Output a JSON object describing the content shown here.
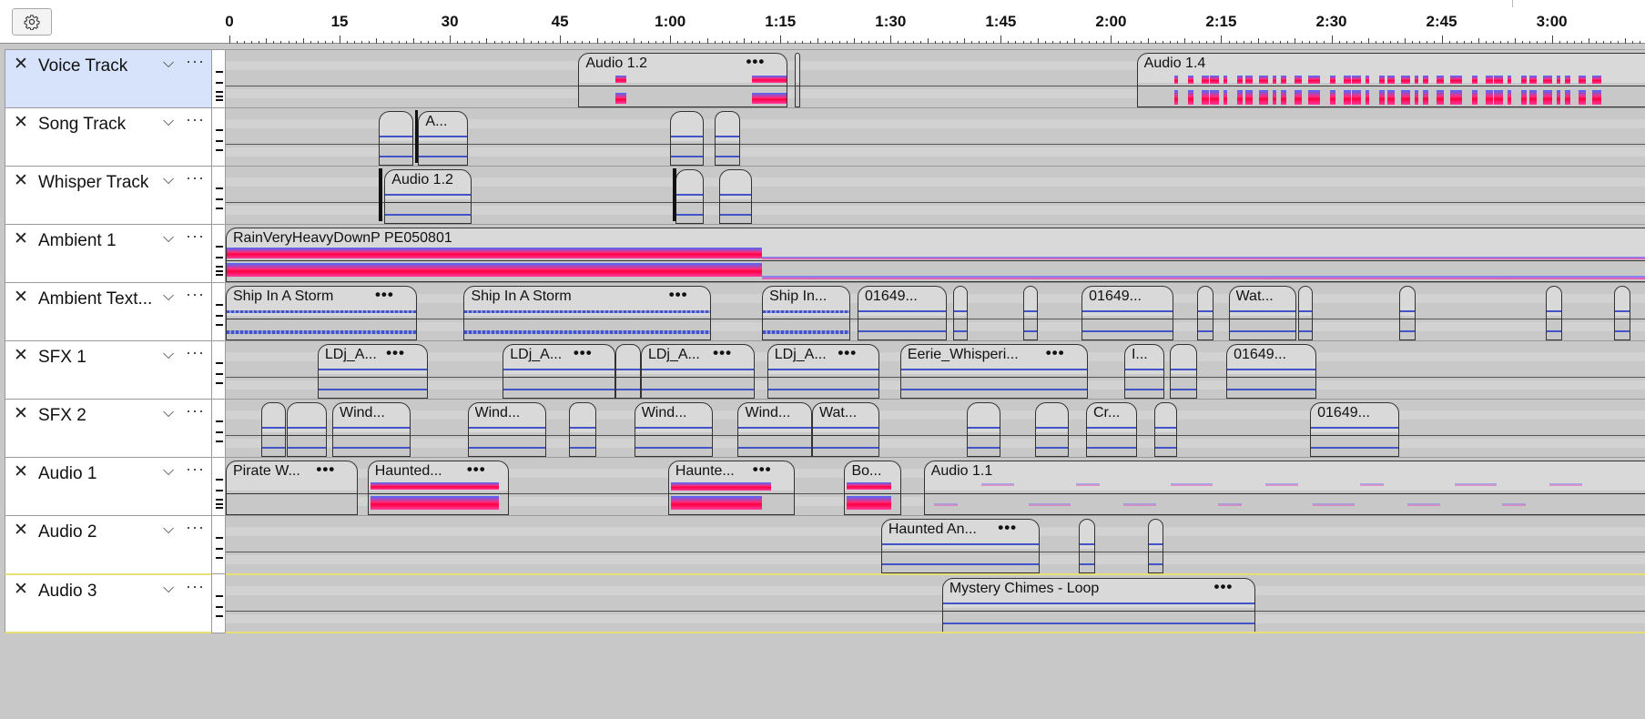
{
  "ruler": {
    "ticks": [
      "0",
      "15",
      "30",
      "45",
      "1:00",
      "1:15",
      "1:30",
      "1:45",
      "2:00",
      "2:15",
      "2:30",
      "2:45",
      "3:00"
    ]
  },
  "icons": {
    "settings": "gear-icon",
    "close": "close-icon",
    "collapse": "chevron-down-icon",
    "menu": "more-horizontal-icon"
  },
  "colors": {
    "selected_track": "#d7e3fb",
    "waveform": "#4354c8",
    "spectrogram_hot": "#ff0040",
    "spectrogram_cool": "#4b6bff",
    "focus_border": "#e6e07a"
  },
  "tracks": [
    {
      "name": "Voice Track",
      "selected": true,
      "clips": [
        {
          "title": "Audio 1.2",
          "dots": "•••",
          "start": 48,
          "end": 76.5,
          "style": "spec-ends"
        },
        {
          "title": "",
          "dots": "",
          "start": 77.5,
          "end": 77.9,
          "style": "plain"
        },
        {
          "title": "Audio 1.4",
          "dots": "",
          "start": 124,
          "end": 196,
          "style": "spec-dense"
        }
      ]
    },
    {
      "name": "Song Track",
      "clips": [
        {
          "title": "",
          "dots": "",
          "start": 20.8,
          "end": 25.5,
          "style": "wave"
        },
        {
          "title": "A...",
          "dots": "",
          "start": 26.2,
          "end": 33,
          "style": "wave"
        },
        {
          "title": "",
          "dots": "",
          "start": 60.5,
          "end": 65,
          "style": "wave"
        },
        {
          "title": "",
          "dots": "",
          "start": 66.5,
          "end": 70,
          "style": "wave"
        }
      ]
    },
    {
      "name": "Whisper Track",
      "clips": [
        {
          "title": "Audio 1.2",
          "dots": "",
          "start": 21.6,
          "end": 33.5,
          "style": "wave"
        },
        {
          "title": "",
          "dots": "",
          "start": 61.2,
          "end": 65,
          "style": "wave"
        },
        {
          "title": "",
          "dots": "",
          "start": 67.2,
          "end": 71.6,
          "style": "wave"
        }
      ]
    },
    {
      "name": "Ambient 1",
      "clips": [
        {
          "title": "RainVeryHeavyDownP PE050801",
          "dots": "",
          "start": 0,
          "end": 196,
          "style": "spec-rain"
        }
      ]
    },
    {
      "name": "Ambient Text...",
      "clips": [
        {
          "title": "Ship In A Storm",
          "dots": "•••",
          "start": 0,
          "end": 26,
          "style": "wave-noisy"
        },
        {
          "title": "Ship In A Storm",
          "dots": "•••",
          "start": 32.4,
          "end": 66,
          "style": "wave-noisy"
        },
        {
          "title": "Ship In...",
          "dots": "",
          "start": 73,
          "end": 85,
          "style": "wave-noisy"
        },
        {
          "title": "01649...",
          "dots": "",
          "start": 86,
          "end": 98.2,
          "style": "wave"
        },
        {
          "title": "",
          "dots": "",
          "start": 99,
          "end": 101,
          "style": "wave"
        },
        {
          "title": "",
          "dots": "",
          "start": 108.5,
          "end": 110.5,
          "style": "wave"
        },
        {
          "title": "01649...",
          "dots": "",
          "start": 116.5,
          "end": 129,
          "style": "wave"
        },
        {
          "title": "",
          "dots": "",
          "start": 132.2,
          "end": 134.4,
          "style": "wave"
        },
        {
          "title": "Wat...",
          "dots": "",
          "start": 136.5,
          "end": 145.7,
          "style": "wave"
        },
        {
          "title": "",
          "dots": "",
          "start": 146,
          "end": 148,
          "style": "wave"
        },
        {
          "title": "",
          "dots": "",
          "start": 159.7,
          "end": 161.9,
          "style": "wave"
        },
        {
          "title": "",
          "dots": "",
          "start": 179.7,
          "end": 181.9,
          "style": "wave"
        },
        {
          "title": "",
          "dots": "",
          "start": 189,
          "end": 191.2,
          "style": "wave"
        }
      ]
    },
    {
      "name": "SFX 1",
      "clips": [
        {
          "title": "LDj_A...",
          "dots": "•••",
          "start": 12.5,
          "end": 27.5,
          "style": "wave"
        },
        {
          "title": "LDj_A...",
          "dots": "•••",
          "start": 37.7,
          "end": 53,
          "style": "wave"
        },
        {
          "title": "",
          "dots": "",
          "start": 53,
          "end": 56.5,
          "style": "wave"
        },
        {
          "title": "LDj_A...",
          "dots": "•••",
          "start": 56.5,
          "end": 72,
          "style": "wave"
        },
        {
          "title": "LDj_A...",
          "dots": "•••",
          "start": 73.7,
          "end": 89,
          "style": "wave"
        },
        {
          "title": "Eerie_Whisperi...",
          "dots": "•••",
          "start": 91.8,
          "end": 117.3,
          "style": "wave"
        },
        {
          "title": "I...",
          "dots": "",
          "start": 122.3,
          "end": 127.7,
          "style": "wave"
        },
        {
          "title": "",
          "dots": "",
          "start": 128.5,
          "end": 132.2,
          "style": "wave"
        },
        {
          "title": "01649...",
          "dots": "",
          "start": 136.2,
          "end": 148.5,
          "style": "wave"
        }
      ]
    },
    {
      "name": "SFX 2",
      "clips": [
        {
          "title": "",
          "dots": "",
          "start": 4.8,
          "end": 8.2,
          "style": "wave"
        },
        {
          "title": "",
          "dots": "",
          "start": 8.3,
          "end": 13.7,
          "style": "wave"
        },
        {
          "title": "Wind...",
          "dots": "",
          "start": 14.5,
          "end": 25.2,
          "style": "wave"
        },
        {
          "title": "Wind...",
          "dots": "",
          "start": 32.9,
          "end": 43.6,
          "style": "wave"
        },
        {
          "title": "",
          "dots": "",
          "start": 46.7,
          "end": 50.4,
          "style": "wave"
        },
        {
          "title": "Wind...",
          "dots": "",
          "start": 55.6,
          "end": 66.3,
          "style": "wave"
        },
        {
          "title": "Wind...",
          "dots": "",
          "start": 69.7,
          "end": 79.8,
          "style": "wave"
        },
        {
          "title": "Wat...",
          "dots": "",
          "start": 79.8,
          "end": 89,
          "style": "wave"
        },
        {
          "title": "",
          "dots": "",
          "start": 100.9,
          "end": 105.4,
          "style": "wave"
        },
        {
          "title": "",
          "dots": "",
          "start": 110.2,
          "end": 114.8,
          "style": "wave"
        },
        {
          "title": "Cr...",
          "dots": "",
          "start": 117.1,
          "end": 124.1,
          "style": "wave"
        },
        {
          "title": "",
          "dots": "",
          "start": 126.4,
          "end": 129.5,
          "style": "wave"
        },
        {
          "title": "01649...",
          "dots": "",
          "start": 147.6,
          "end": 159.7,
          "style": "wave"
        }
      ]
    },
    {
      "name": "Audio 1",
      "clips": [
        {
          "title": "Pirate W...",
          "dots": "•••",
          "start": 0,
          "end": 18,
          "style": "plain"
        },
        {
          "title": "Haunted...",
          "dots": "•••",
          "start": 19.3,
          "end": 38.5,
          "style": "spec-block"
        },
        {
          "title": "Haunte...",
          "dots": "•••",
          "start": 60.2,
          "end": 77.4,
          "style": "spec-fade"
        },
        {
          "title": "Bo...",
          "dots": "",
          "start": 84.2,
          "end": 92,
          "style": "spec-block"
        },
        {
          "title": "Audio 1.1",
          "dots": "",
          "start": 95,
          "end": 196,
          "style": "faint"
        }
      ]
    },
    {
      "name": "Audio 2",
      "clips": [
        {
          "title": "Haunted An...",
          "dots": "•••",
          "start": 89.2,
          "end": 110.8,
          "style": "wave"
        },
        {
          "title": "",
          "dots": "",
          "start": 116.1,
          "end": 118.3,
          "style": "wave"
        },
        {
          "title": "",
          "dots": "",
          "start": 125.5,
          "end": 127.6,
          "style": "wave"
        }
      ]
    },
    {
      "name": "Audio 3",
      "focused": true,
      "clips": [
        {
          "title": "Mystery Chimes - Loop",
          "dots": "•••",
          "start": 97.5,
          "end": 140.2,
          "style": "wave"
        }
      ]
    }
  ]
}
